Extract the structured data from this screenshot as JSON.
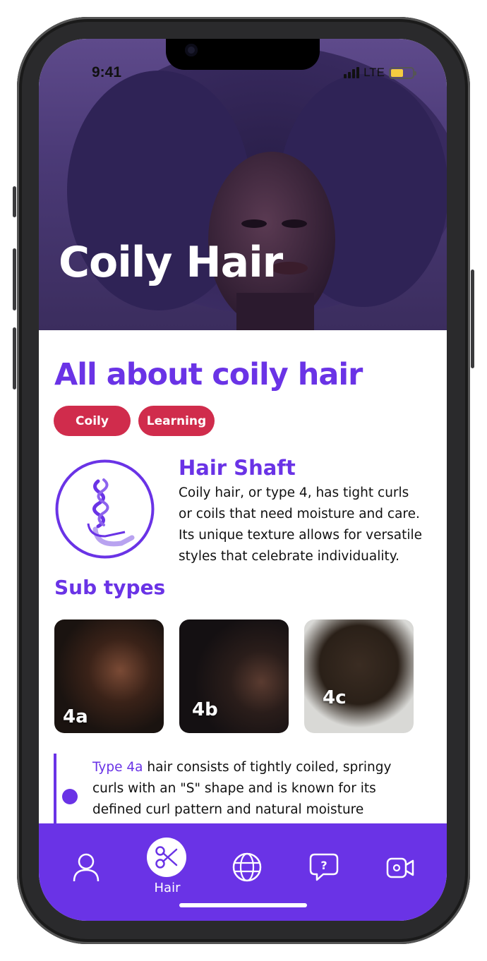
{
  "status": {
    "time": "9:41",
    "network": "LTE"
  },
  "hero": {
    "title": "Coily Hair"
  },
  "article": {
    "heading": "All about coily hair",
    "tags": [
      "Coily",
      "Learning"
    ],
    "section_title": "Hair Shaft",
    "section_text": "Coily hair, or type 4, has tight curls or coils that need moisture and care. Its unique texture allows for versatile styles that celebrate individuality.",
    "subtypes_title": "Sub types",
    "subtypes": [
      {
        "label": "4a"
      },
      {
        "label": "4b"
      },
      {
        "label": "4c"
      }
    ],
    "detail_highlight": "Type 4a",
    "detail_text": " hair consists of tightly coiled, springy curls with an \"S\" shape and is known for its defined curl pattern and natural moisture retention."
  },
  "tabbar": {
    "items": [
      {
        "icon": "person-icon",
        "label": ""
      },
      {
        "icon": "scissors-icon",
        "label": "Hair"
      },
      {
        "icon": "globe-icon",
        "label": ""
      },
      {
        "icon": "question-chat-icon",
        "label": ""
      },
      {
        "icon": "video-icon",
        "label": ""
      }
    ]
  },
  "colors": {
    "accent": "#6a33e6",
    "tag": "#d02c4c",
    "hero": "#4b3a77"
  }
}
